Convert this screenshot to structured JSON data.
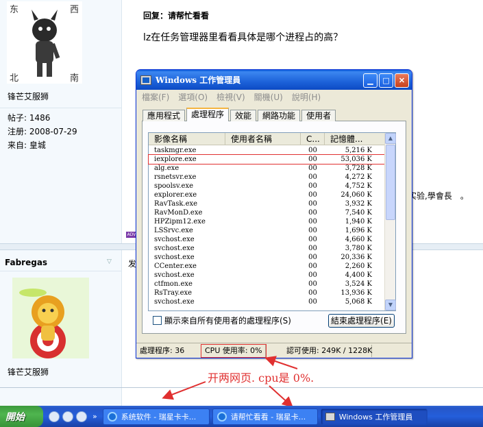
{
  "forum": {
    "user1": {
      "name": "锋芒艾服狮",
      "posts_label": "帖子: 1486",
      "registered_label": "注册: 2008-07-29",
      "from_label": "来自: 皇城",
      "avatar_text": [
        "东",
        "西",
        "北",
        "南"
      ]
    },
    "reply_title": "回复：请帮忙看看",
    "reply_body": "lz在任务管理器里看看具体是哪个进程占的高？",
    "signature_fragment": "实验,學會長　。",
    "ad_tag": "ADV",
    "user2": {
      "name": "Fabregas",
      "post_start": "发",
      "display_name": "锋芒艾服狮"
    }
  },
  "window": {
    "title": "Windows 工作管理員",
    "menu": [
      "檔案(F)",
      "選項(O)",
      "檢視(V)",
      "關機(U)",
      "說明(H)"
    ],
    "tabs": [
      "應用程式",
      "處理程序",
      "效能",
      "網路功能",
      "使用者"
    ],
    "active_tab": 1,
    "columns": [
      "影像名稱",
      "使用者名稱",
      "C...",
      "記憶體..."
    ],
    "processes": [
      {
        "name": "taskmgr.exe",
        "user": "",
        "cpu": "00",
        "mem": "5,216 K"
      },
      {
        "name": "iexplore.exe",
        "user": "",
        "cpu": "00",
        "mem": "53,036 K",
        "highlighted": true
      },
      {
        "name": "alg.exe",
        "user": "",
        "cpu": "00",
        "mem": "3,728 K"
      },
      {
        "name": "rsnetsvr.exe",
        "user": "",
        "cpu": "00",
        "mem": "4,272 K"
      },
      {
        "name": "spoolsv.exe",
        "user": "",
        "cpu": "00",
        "mem": "4,752 K"
      },
      {
        "name": "explorer.exe",
        "user": "",
        "cpu": "00",
        "mem": "24,060 K"
      },
      {
        "name": "RavTask.exe",
        "user": "",
        "cpu": "00",
        "mem": "3,932 K"
      },
      {
        "name": "RavMonD.exe",
        "user": "",
        "cpu": "00",
        "mem": "7,540 K"
      },
      {
        "name": "HPZipm12.exe",
        "user": "",
        "cpu": "00",
        "mem": "1,940 K"
      },
      {
        "name": "LSSrvc.exe",
        "user": "",
        "cpu": "00",
        "mem": "1,696 K"
      },
      {
        "name": "svchost.exe",
        "user": "",
        "cpu": "00",
        "mem": "4,660 K"
      },
      {
        "name": "svchost.exe",
        "user": "",
        "cpu": "00",
        "mem": "3,780 K"
      },
      {
        "name": "svchost.exe",
        "user": "",
        "cpu": "00",
        "mem": "20,336 K"
      },
      {
        "name": "CCenter.exe",
        "user": "",
        "cpu": "00",
        "mem": "2,260 K"
      },
      {
        "name": "svchost.exe",
        "user": "",
        "cpu": "00",
        "mem": "4,400 K"
      },
      {
        "name": "ctfmon.exe",
        "user": "",
        "cpu": "00",
        "mem": "3,524 K"
      },
      {
        "name": "RsTray.exe",
        "user": "",
        "cpu": "00",
        "mem": "13,936 K"
      },
      {
        "name": "svchost.exe",
        "user": "",
        "cpu": "00",
        "mem": "5,068 K"
      }
    ],
    "show_all_users_label": "顯示來自所有使用者的處理程序(S)",
    "end_process_label": "結束處理程序(E)",
    "status": {
      "processes": "處理程序: 36",
      "cpu": "CPU 使用率: 0%",
      "commit": "認可使用: 249K / 1228K"
    }
  },
  "annotation": "开两网页. cpu是  0%.",
  "taskbar": {
    "start_label": "開始",
    "quicklaunch_more": "»",
    "items": [
      {
        "label": "系统软件 - 瑞星卡卡...",
        "icon": "ie-icon"
      },
      {
        "label": "请帮忙看看 - 瑞星卡...",
        "icon": "ie-icon"
      },
      {
        "label": "Windows 工作管理員",
        "icon": "taskmgr-icon"
      }
    ]
  }
}
